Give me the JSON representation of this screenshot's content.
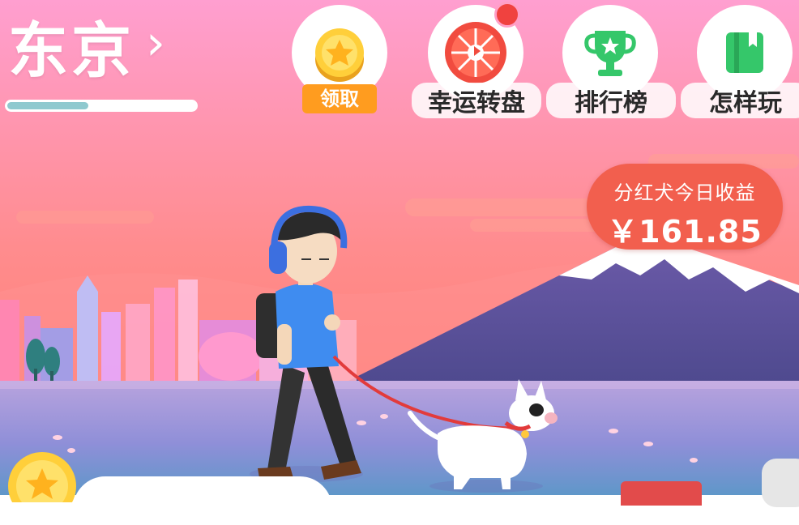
{
  "header": {
    "city_name": "东京",
    "city_progress": 0.43
  },
  "actions": [
    {
      "id": "claim",
      "label": "领取",
      "icon": "gold-coin-star-icon",
      "badge": false
    },
    {
      "id": "wheel",
      "label": "幸运转盘",
      "icon": "lucky-wheel-icon",
      "badge": true
    },
    {
      "id": "rank",
      "label": "排行榜",
      "icon": "trophy-icon",
      "badge": false
    },
    {
      "id": "how",
      "label": "怎样玩",
      "icon": "guide-book-icon",
      "badge": false
    }
  ],
  "earnings": {
    "title": "分红犬今日收益",
    "amount": "￥161.85"
  },
  "colors": {
    "sky_top": "#ff9ccf",
    "sky_bottom": "#ff7d70",
    "claim_orange": "#ff9c1f",
    "earn_bubble": "#f25f4e",
    "progress_fill": "#8fc9cf",
    "badge_red": "#f0423f"
  }
}
